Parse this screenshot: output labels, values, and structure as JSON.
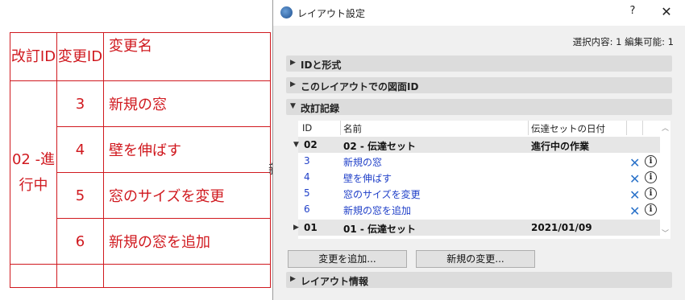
{
  "background_table": {
    "headers": {
      "rev_id": "改訂ID",
      "change_id": "変更ID",
      "change_name": "変更名"
    },
    "revision_label": "02 -進行中",
    "rows": [
      {
        "id": "3",
        "name": "新規の窓"
      },
      {
        "id": "4",
        "name": "壁を伸ばす"
      },
      {
        "id": "5",
        "name": "窓のサイズを変更"
      },
      {
        "id": "6",
        "name": "新規の窓を追加"
      }
    ],
    "peek_text": "新"
  },
  "dialog": {
    "title": "レイアウト設定",
    "help_label": "?",
    "close_label": "✕",
    "selection_info": "選択内容: 1 編集可能: 1",
    "sections": [
      {
        "label": "IDと形式",
        "arrow": "▶",
        "expanded": false
      },
      {
        "label": "このレイアウトでの図面ID",
        "arrow": "▶",
        "expanded": false
      },
      {
        "label": "改訂記録",
        "arrow": "▼",
        "expanded": true
      }
    ],
    "revision_table": {
      "columns": {
        "id": "ID",
        "name": "名前",
        "date": "伝達セットの日付"
      },
      "groups": [
        {
          "toggle": "▼",
          "id": "02",
          "name": "02 - 伝達セット",
          "date": "進行中の作業",
          "items": [
            {
              "id": "3",
              "name": "新規の窓"
            },
            {
              "id": "4",
              "name": "壁を伸ばす"
            },
            {
              "id": "5",
              "name": "窓のサイズを変更"
            },
            {
              "id": "6",
              "name": "新規の窓を追加"
            }
          ]
        },
        {
          "toggle": "▶",
          "id": "01",
          "name": "01 - 伝達セット",
          "date": "2021/01/09",
          "items": []
        }
      ],
      "delete_icon": "✕",
      "info_icon": "i"
    },
    "buttons": {
      "add_change": "変更を追加...",
      "new_change": "新規の変更..."
    },
    "layout_info_section": {
      "label": "レイアウト情報",
      "arrow": "▶"
    },
    "colors": {
      "accent_blue": "#1f3fc8",
      "delete_blue": "#2a72c9",
      "red": "#d0191f"
    }
  }
}
